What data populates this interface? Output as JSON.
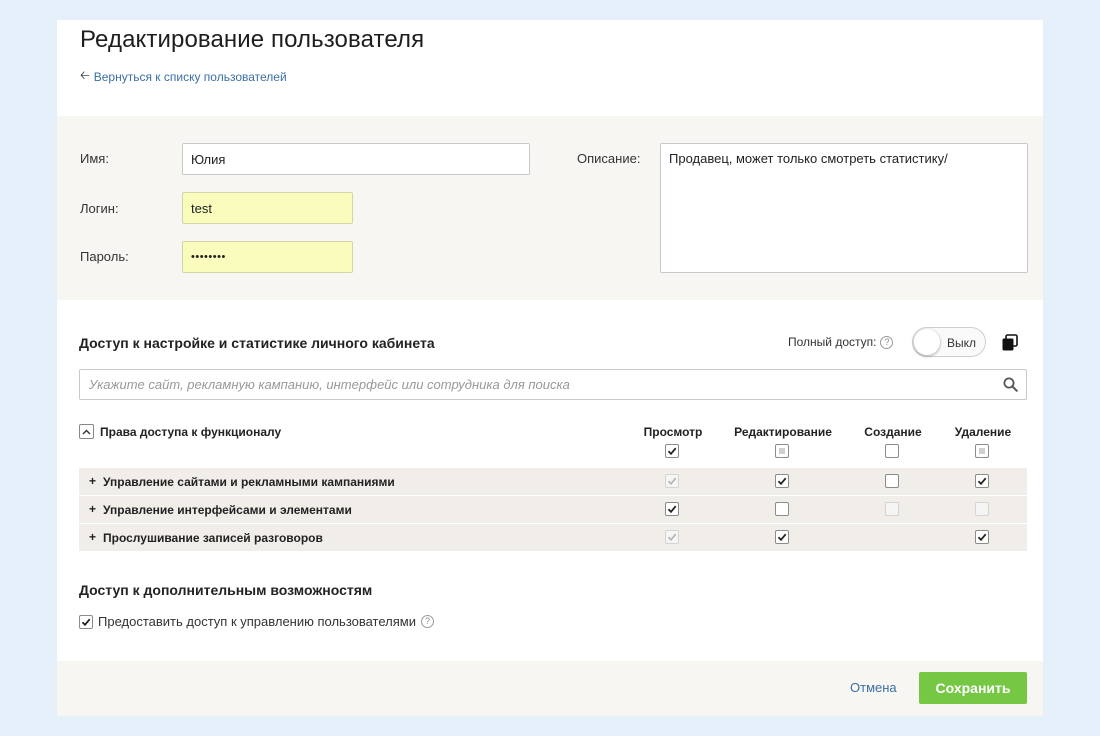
{
  "page": {
    "title": "Редактирование пользователя",
    "back_link": "Вернуться к списку пользователей"
  },
  "form": {
    "name_label": "Имя:",
    "name_value": "Юлия",
    "login_label": "Логин:",
    "login_value": "test",
    "password_label": "Пароль:",
    "password_value": "••••••••",
    "description_label": "Описание:",
    "description_value": "Продавец, может только смотреть статистику/"
  },
  "access": {
    "title": "Доступ к настройке и статистике личного кабинета",
    "full_access_label": "Полный доступ:",
    "toggle_text": "Выкл",
    "toggle_on": false,
    "search_placeholder": "Укажите сайт, рекламную кампанию, интерфейс или сотрудника для поиска",
    "permissions_header": "Права доступа к функционалу",
    "columns": [
      "Просмотр",
      "Редактирование",
      "Создание",
      "Удаление"
    ],
    "header_checks": [
      "checked",
      "partial",
      "unchecked",
      "partial"
    ],
    "rows": [
      {
        "label": "Управление сайтами и рекламными кампаниями",
        "checks": [
          "checked-disabled",
          "checked",
          "unchecked",
          "checked"
        ]
      },
      {
        "label": "Управление интерфейсами и элементами",
        "checks": [
          "checked",
          "unchecked",
          "disabled",
          "disabled"
        ]
      },
      {
        "label": "Прослушивание записей разговоров",
        "checks": [
          "checked-disabled",
          "checked",
          "none",
          "checked"
        ]
      }
    ]
  },
  "extra": {
    "title": "Доступ к дополнительным возможностям",
    "user_mgmt_label": "Предоставить доступ к управлению пользователями",
    "user_mgmt_checked": true
  },
  "footer": {
    "cancel_label": "Отмена",
    "save_label": "Сохранить",
    "save_color": "#75c744"
  },
  "colors": {
    "link": "#3b6fa5",
    "highlight_input": "#fafcbd",
    "panel_bg": "#f7f6f3",
    "row_bg": "#f1eeea",
    "page_bg": "#e6f0fb"
  },
  "icons": [
    "arrow-left-icon",
    "question-icon",
    "copy-icon",
    "search-icon",
    "collapse-icon",
    "plus-icon",
    "checkmark-icon"
  ]
}
